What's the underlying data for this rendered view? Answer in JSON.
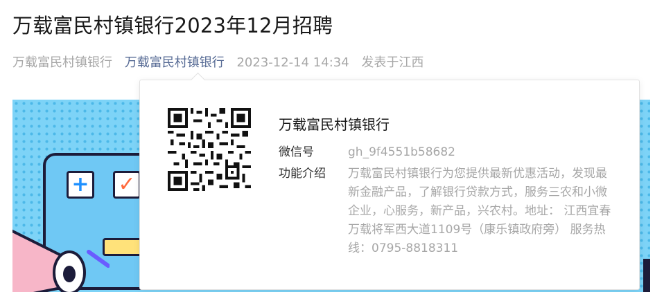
{
  "article": {
    "title": "万载富民村镇银行2023年12月招聘",
    "meta": {
      "author": "万载富民村镇银行",
      "account": "万载富民村镇银行",
      "datetime": "2023-12-14 14:34",
      "location": "发表于江西"
    }
  },
  "popup": {
    "account_name": "万载富民村镇银行",
    "wechat_id_label": "微信号",
    "wechat_id": "gh_9f4551b58682",
    "intro_label": "功能介绍",
    "intro": "万载富民村镇银行为您提供最新优惠活动，发现最新金融产品，了解银行贷款方式，服务三农和小微企业，心服务，新产品，兴农村。地址： 江西宜春万载将军西大道1109号（康乐镇政府旁） 服务热线：0795-8818311"
  },
  "colors": {
    "link": "#576b95",
    "muted": "#a7a7a7"
  }
}
